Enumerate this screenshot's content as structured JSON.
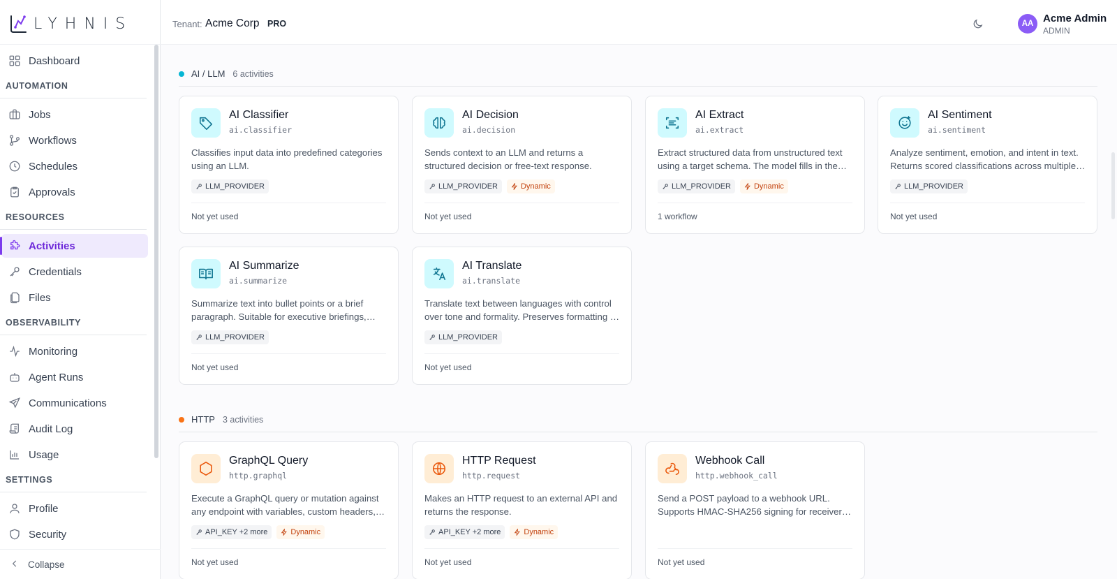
{
  "brand": {
    "logo_text": "LYHNIS"
  },
  "header": {
    "tenant_label": "Tenant:",
    "tenant_name": "Acme Corp",
    "plan": "PRO",
    "user": {
      "initials": "AA",
      "name": "Acme Admin",
      "role": "ADMIN"
    }
  },
  "sidebar": {
    "dashboard": "Dashboard",
    "sections": {
      "automation": "AUTOMATION",
      "resources": "RESOURCES",
      "observability": "OBSERVABILITY",
      "settings": "SETTINGS"
    },
    "items": {
      "jobs": "Jobs",
      "workflows": "Workflows",
      "schedules": "Schedules",
      "approvals": "Approvals",
      "activities": "Activities",
      "credentials": "Credentials",
      "files": "Files",
      "monitoring": "Monitoring",
      "agent_runs": "Agent Runs",
      "communications": "Communications",
      "audit_log": "Audit Log",
      "usage": "Usage",
      "profile": "Profile",
      "security": "Security"
    },
    "active": "Activities",
    "collapse": "Collapse"
  },
  "groups": [
    {
      "name": "AI / LLM",
      "count": "6 activities",
      "color": "#06b6d4",
      "cards": [
        {
          "title": "AI Classifier",
          "slug": "ai.classifier",
          "icon": "tag-icon",
          "desc": "Classifies input data into predefined categories using an LLM.",
          "cred": "LLM_PROVIDER",
          "dynamic": "",
          "usage": "Not yet used"
        },
        {
          "title": "AI Decision",
          "slug": "ai.decision",
          "icon": "brain-icon",
          "desc": "Sends context to an LLM and returns a structured decision or free-text response.",
          "cred": "LLM_PROVIDER",
          "dynamic": "Dynamic",
          "usage": "Not yet used"
        },
        {
          "title": "AI Extract",
          "slug": "ai.extract",
          "icon": "scan-text-icon",
          "desc": "Extract structured data from unstructured text using a target schema. The model fills in the fields.",
          "cred": "LLM_PROVIDER",
          "dynamic": "Dynamic",
          "usage": "1 workflow"
        },
        {
          "title": "AI Sentiment",
          "slug": "ai.sentiment",
          "icon": "smile-plus-icon",
          "desc": "Analyze sentiment, emotion, and intent in text. Returns scored classifications across multiple dimensions.",
          "cred": "LLM_PROVIDER",
          "dynamic": "",
          "usage": "Not yet used"
        },
        {
          "title": "AI Summarize",
          "slug": "ai.summarize",
          "icon": "book-open-icon",
          "desc": "Summarize text into bullet points or a brief paragraph. Suitable for executive briefings, reports.",
          "cred": "LLM_PROVIDER",
          "dynamic": "",
          "usage": "Not yet used"
        },
        {
          "title": "AI Translate",
          "slug": "ai.translate",
          "icon": "languages-icon",
          "desc": "Translate text between languages with control over tone and formality. Preserves formatting of the source.",
          "cred": "LLM_PROVIDER",
          "dynamic": "",
          "usage": "Not yet used"
        }
      ]
    },
    {
      "name": "HTTP",
      "count": "3 activities",
      "color": "#f97316",
      "cards": [
        {
          "title": "GraphQL Query",
          "slug": "http.graphql",
          "icon": "hexagon-icon",
          "desc": "Execute a GraphQL query or mutation against any endpoint with variables, custom headers, and auth.",
          "cred": "API_KEY +2 more",
          "dynamic": "Dynamic",
          "usage": "Not yet used"
        },
        {
          "title": "HTTP Request",
          "slug": "http.request",
          "icon": "globe-icon",
          "desc": "Makes an HTTP request to an external API and returns the response.",
          "cred": "API_KEY +2 more",
          "dynamic": "Dynamic",
          "usage": "Not yet used"
        },
        {
          "title": "Webhook Call",
          "slug": "http.webhook_call",
          "icon": "webhook-icon",
          "desc": "Send a POST payload to a webhook URL. Supports HMAC-SHA256 signing for receiver verification.",
          "cred": "",
          "dynamic": "",
          "usage": "Not yet used"
        }
      ]
    }
  ]
}
